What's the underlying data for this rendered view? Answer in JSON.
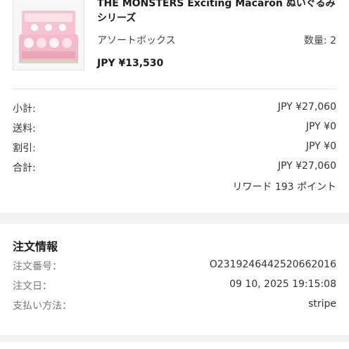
{
  "product": {
    "title": "THE MONSTERS Exciting Macaron ぬいぐるみシリーズ",
    "variant": "アソートボックス",
    "quantity": "数量: 2",
    "price": "JPY ¥13,530"
  },
  "summary": {
    "rows": [
      {
        "label": "小計:",
        "value": "JPY ¥27,060"
      },
      {
        "label": "送料:",
        "value": "JPY ¥0"
      },
      {
        "label": "割引:",
        "value": "JPY ¥0"
      },
      {
        "label": "合計:",
        "value": "JPY ¥27,060"
      }
    ],
    "reward": "リワード 193 ポイント"
  },
  "order_info": {
    "title": "注文情報",
    "rows": [
      {
        "label": "注文番号：",
        "value": "O2319246442520662016"
      },
      {
        "label": "注文日：",
        "value": "09 10, 2025 19:15:08"
      },
      {
        "label": "支払い方法：",
        "value": "stripe"
      }
    ]
  },
  "colors": {
    "background": "#f2f2f2",
    "card": "#ffffff",
    "box_pink": "#f3b9c6"
  }
}
